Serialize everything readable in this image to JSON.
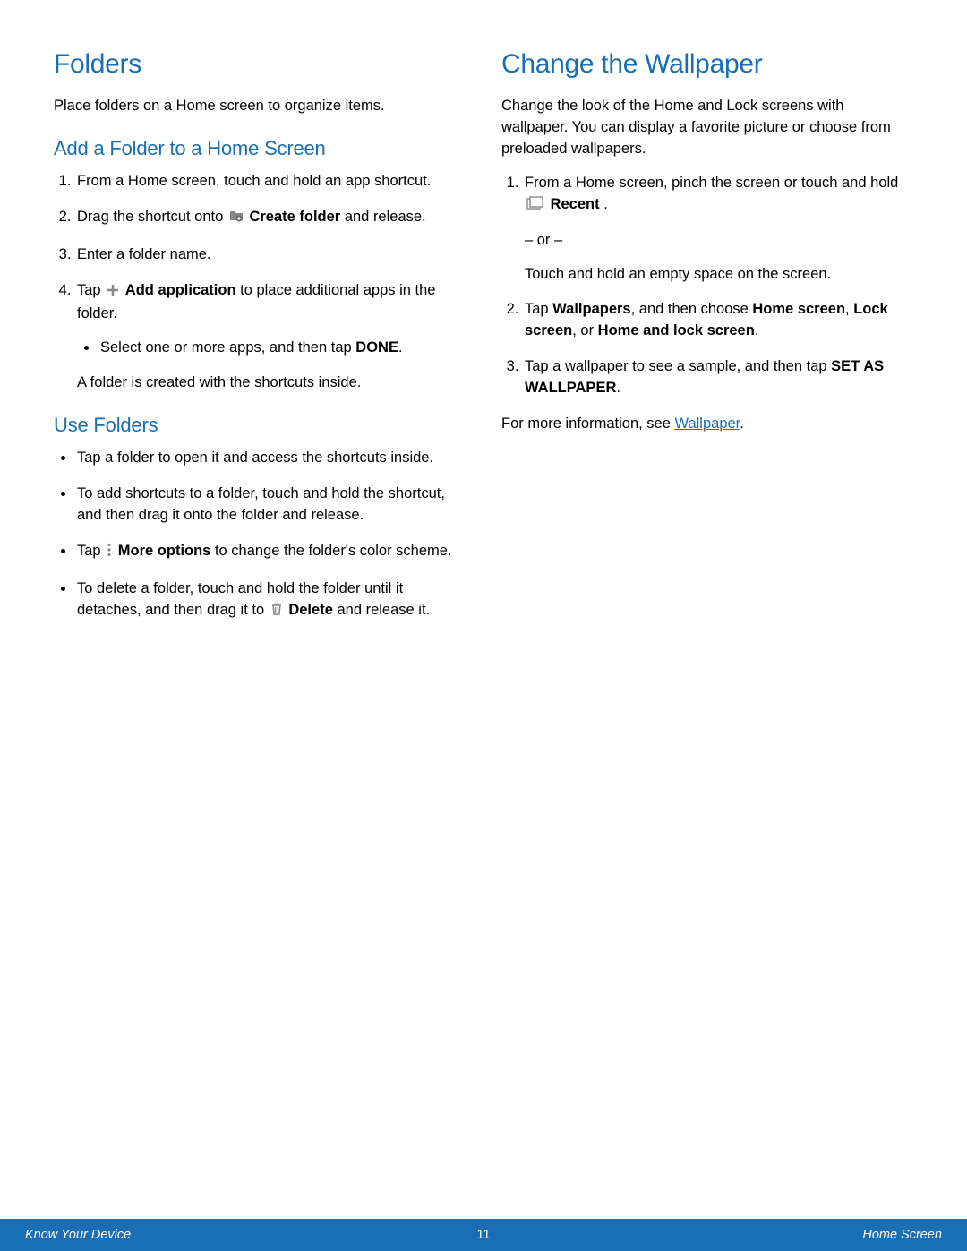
{
  "left": {
    "h1": "Folders",
    "intro": "Place folders on a Home screen to organize items.",
    "h2a": "Add a Folder to a Home Screen",
    "ol": {
      "i1": "From a Home screen, touch and hold an app shortcut.",
      "i2a": "Drag the shortcut onto ",
      "i2b": "Create folder",
      "i2c": " and release.",
      "i3": "Enter a folder name.",
      "i4a": "Tap ",
      "i4b": "Add application",
      "i4c": " to place additional apps in the folder.",
      "i4_sub_a": "Select one or more apps, and then tap ",
      "i4_sub_b": "DONE",
      "i4_sub_c": "."
    },
    "after_ol": "A folder is created with the shortcuts inside.",
    "h2b": "Use Folders",
    "ul": {
      "b1": "Tap a folder to open it and access the shortcuts inside.",
      "b2": "To add shortcuts to a folder, touch and hold the shortcut, and then drag it onto the folder and release.",
      "b3a": "Tap ",
      "b3b": "More options",
      "b3c": " to change the folder's color scheme.",
      "b4a": "To delete a folder, touch and hold the folder until it detaches, and then drag it to ",
      "b4b": "Delete",
      "b4c": " and release it."
    }
  },
  "right": {
    "h1": "Change the Wallpaper",
    "intro": "Change the look of the Home and Lock screens with wallpaper. You can display a favorite picture or choose from preloaded wallpapers.",
    "ol": {
      "i1a": "From a Home screen, pinch the screen or touch and hold ",
      "i1b": "Recent",
      "i1c": " .",
      "or": "– or –",
      "i1d": "Touch and hold an empty space on the screen.",
      "i2a": "Tap ",
      "i2b": "Wallpapers",
      "i2c": ", and then choose ",
      "i2d": "Home screen",
      "i2e": ", ",
      "i2f": "Lock screen",
      "i2g": ", or ",
      "i2h": "Home and lock screen",
      "i2i": ".",
      "i3a": "Tap a wallpaper to see a sample, and then tap ",
      "i3b": "SET AS WALLPAPER",
      "i3c": "."
    },
    "more_a": "For more information, see ",
    "more_link": "Wallpaper",
    "more_b": "."
  },
  "footer": {
    "left": "Know Your Device",
    "center": "11",
    "right": "Home Screen"
  }
}
